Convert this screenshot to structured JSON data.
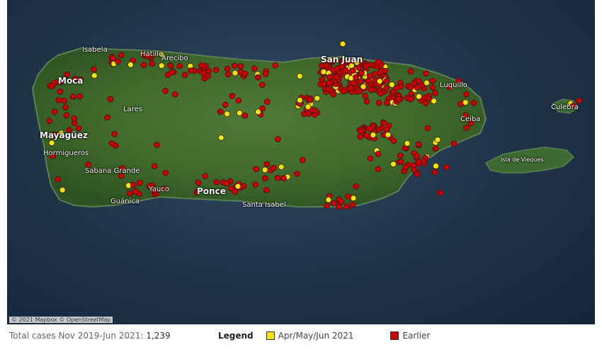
{
  "map": {
    "attribution": "© 2021 Mapbox © OpenStreetMap",
    "colors": {
      "recent": "#f2e600",
      "earlier": "#cc0000",
      "marker_border": "#3a1a1a"
    },
    "places": [
      {
        "name": "Isabela",
        "size": "normal"
      },
      {
        "name": "Hatillo",
        "size": "normal"
      },
      {
        "name": "Arecibo",
        "size": "normal"
      },
      {
        "name": "San Juan",
        "size": "big"
      },
      {
        "name": "Moca",
        "size": "big"
      },
      {
        "name": "Lares",
        "size": "normal"
      },
      {
        "name": "Mayagüez",
        "size": "big"
      },
      {
        "name": "Hormigueros",
        "size": "normal"
      },
      {
        "name": "Sabana Grande",
        "size": "normal"
      },
      {
        "name": "Yauco",
        "size": "normal"
      },
      {
        "name": "Guánica",
        "size": "normal"
      },
      {
        "name": "Ponce",
        "size": "big"
      },
      {
        "name": "Santa Isabel",
        "size": "normal"
      },
      {
        "name": "Luquillo",
        "size": "normal"
      },
      {
        "name": "Ceiba",
        "size": "normal"
      },
      {
        "name": "Culebra",
        "size": "normal"
      },
      {
        "name": "Isla de Vieques",
        "size": "normal"
      }
    ]
  },
  "footer": {
    "label": "Total cases Nov 2019-Jun 2021:",
    "value": "1,239"
  },
  "legend": {
    "title": "Legend",
    "items": [
      {
        "label": "Apr/May/Jun 2021",
        "color": "#f2e600"
      },
      {
        "label": "Earlier",
        "color": "#cc0000"
      }
    ]
  }
}
